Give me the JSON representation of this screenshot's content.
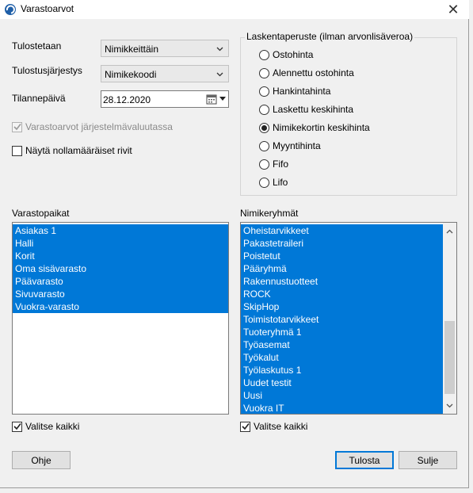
{
  "window": {
    "title": "Varastoarvot",
    "close_glyph": "✕"
  },
  "form": {
    "tulostetaan_label": "Tulostetaan",
    "tulostetaan_value": "Nimikkeittäin",
    "jarjestys_label": "Tulostusjärjestys",
    "jarjestys_value": "Nimikekoodi",
    "paiva_label": "Tilannepäivä",
    "paiva_value": "28.12.2020",
    "jarjestelma_check_label": "Varastoarvot järjestelmävaluutassa",
    "jarjestelma_checked": true,
    "nollamaara_check_label": "Näytä nollamääräiset rivit",
    "nollamaara_checked": false
  },
  "laskentaperuste": {
    "title": "Laskentaperuste (ilman arvonlisäveroa)",
    "options": [
      {
        "label": "Ostohinta",
        "selected": false
      },
      {
        "label": "Alennettu ostohinta",
        "selected": false
      },
      {
        "label": "Hankintahinta",
        "selected": false
      },
      {
        "label": "Laskettu keskihinta",
        "selected": false
      },
      {
        "label": "Nimikekortin keskihinta",
        "selected": true
      },
      {
        "label": "Myyntihinta",
        "selected": false
      },
      {
        "label": "Fifo",
        "selected": false
      },
      {
        "label": "Lifo",
        "selected": false
      }
    ]
  },
  "varastopaikat": {
    "title": "Varastopaikat",
    "items": [
      "Asiakas 1",
      "Halli",
      "Korit",
      "Oma sisävarasto",
      "Päävarasto",
      "Sivuvarasto",
      "Vuokra-varasto"
    ],
    "select_all_label": "Valitse kaikki",
    "select_all_checked": true
  },
  "nimikeryhmat": {
    "title": "Nimikeryhmät",
    "items": [
      "Oheistarvikkeet",
      "Pakastetraileri",
      "Poistetut",
      "Pääryhmä",
      "Rakennustuotteet",
      "ROCK",
      "SkipHop",
      "Toimistotarvikkeet",
      "Tuoteryhmä 1",
      "Työasemat",
      "Työkalut",
      "Työlaskutus 1",
      "Uudet testit",
      "Uusi",
      "Vuokra IT"
    ],
    "select_all_label": "Valitse kaikki",
    "select_all_checked": true
  },
  "buttons": {
    "help": "Ohje",
    "print": "Tulosta",
    "close": "Sulje"
  },
  "colors": {
    "selection": "#0078d7",
    "default_button_border": "#0078d7"
  }
}
